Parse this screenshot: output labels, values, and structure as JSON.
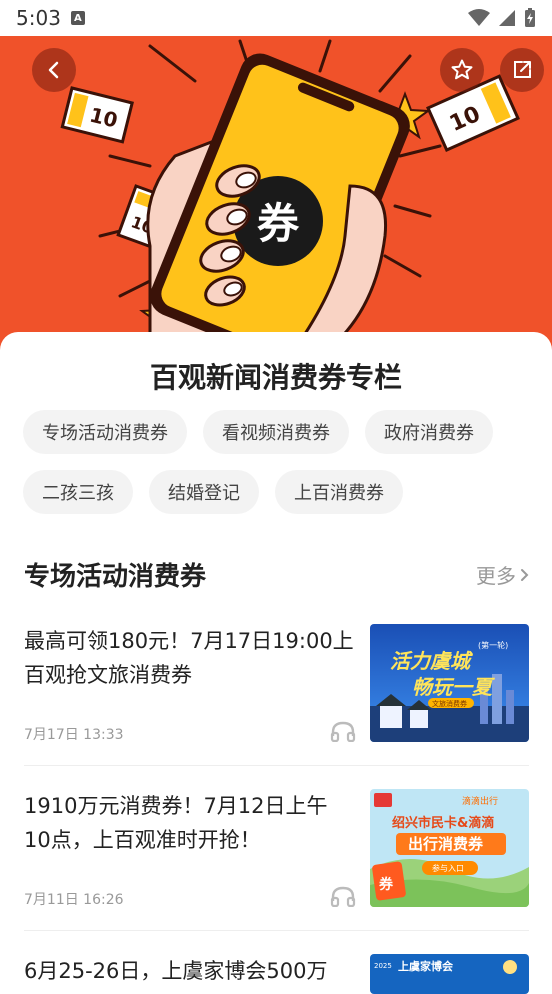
{
  "status_bar": {
    "time": "5:03"
  },
  "hero": {
    "icon_text": "券",
    "note_value": "10"
  },
  "page": {
    "title": "百观新闻消费券专栏"
  },
  "chips": [
    "专场活动消费券",
    "看视频消费券",
    "政府消费券",
    "二孩三孩",
    "结婚登记",
    "上百消费券"
  ],
  "section": {
    "title": "专场活动消费券",
    "more_label": "更多"
  },
  "news": [
    {
      "title": "最高可领180元！7月17日19:00上百观抢文旅消费券",
      "time": "7月17日 13:33",
      "thumb": {
        "line1": "活力虞城",
        "line2": "畅玩一夏",
        "badge": "(第一轮)",
        "tag": "文旅消费券"
      }
    },
    {
      "title": "1910万元消费券！7月12日上午10点，上百观准时开抢！",
      "time": "7月11日 16:26",
      "thumb": {
        "top_right": "滴滴出行",
        "line1": "绍兴市民卡&滴滴",
        "line2": "出行消费券",
        "button": "参与入口",
        "coupon": "券"
      }
    },
    {
      "title": "6月25-26日，上虞家博会500万",
      "thumb": {
        "label": "上虞家博会",
        "year": "2025"
      }
    }
  ],
  "colors": {
    "hero_bg": "#f0522a",
    "phone_yellow": "#ffc21a",
    "accent": "#e23d28"
  }
}
